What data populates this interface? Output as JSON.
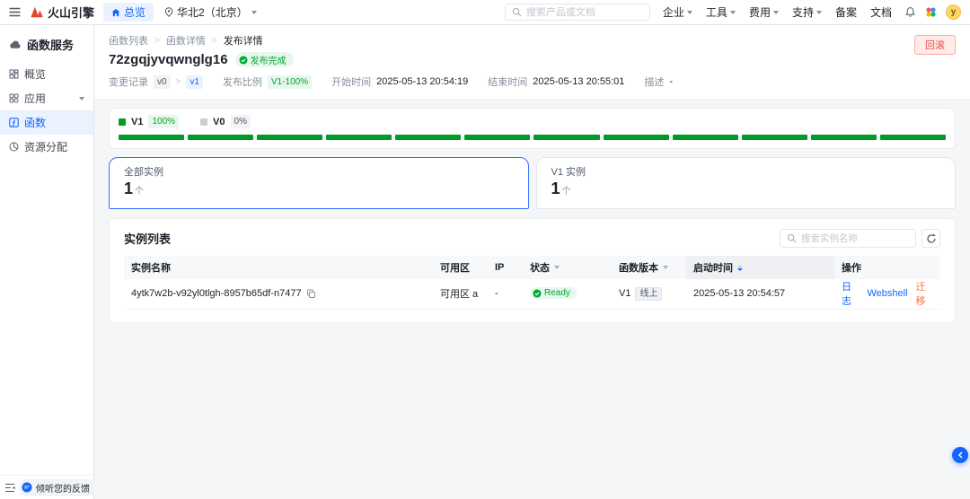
{
  "topbar": {
    "brand": "火山引擎",
    "overview_tab": "总览",
    "region": "华北2（北京）",
    "search_placeholder": "搜索产品或文档",
    "menu": [
      "企业",
      "工具",
      "费用",
      "支持",
      "备案",
      "文档"
    ],
    "avatar_letter": "y"
  },
  "sidebar": {
    "title": "函数服务",
    "items": [
      {
        "label": "概览"
      },
      {
        "label": "应用"
      },
      {
        "label": "函数"
      },
      {
        "label": "资源分配"
      }
    ],
    "feedback_label": "倾听您的反馈"
  },
  "header": {
    "breadcrumb": [
      "函数列表",
      "函数详情",
      "发布详情"
    ],
    "title": "72zgqjyvqwnglg16",
    "status_badge": "发布完成",
    "rollback_button": "回滚",
    "meta": {
      "change_label": "变更记录",
      "change_from": "v0",
      "change_to": "v1",
      "ratio_label": "发布比例",
      "ratio_value": "V1-100%",
      "start_label": "开始时间",
      "start_value": "2025-05-13 20:54:19",
      "end_label": "结束时间",
      "end_value": "2025-05-13 20:55:01",
      "desc_label": "描述",
      "desc_value": "-"
    }
  },
  "progress": {
    "v1_label": "V1",
    "v1_percent": "100%",
    "v0_label": "V0",
    "v0_percent": "0%",
    "segments": 12
  },
  "tabs": [
    {
      "label": "全部实例",
      "count": "1",
      "unit": "个"
    },
    {
      "label": "V1 实例",
      "count": "1",
      "unit": "个"
    }
  ],
  "instances": {
    "title": "实例列表",
    "search_placeholder": "搜索实例名称",
    "headers": [
      "实例名称",
      "可用区",
      "IP",
      "状态",
      "函数版本",
      "启动时间",
      "操作"
    ],
    "rows": [
      {
        "name": "4ytk7w2b-v92yl0tlgh-8957b65df-n7477",
        "zone": "可用区 a",
        "ip": "-",
        "status": "Ready",
        "version": "V1",
        "version_tag": "线上",
        "started": "2025-05-13 20:54:57",
        "actions": [
          "日志",
          "Webshell",
          "迁移"
        ]
      }
    ]
  },
  "colors": {
    "accent_blue": "#1664ff",
    "brand_red": "#e8442e",
    "success_green": "#00a82d",
    "bar_green": "#009a29",
    "danger_red": "#f54a45",
    "action_orange": "#f77234"
  }
}
